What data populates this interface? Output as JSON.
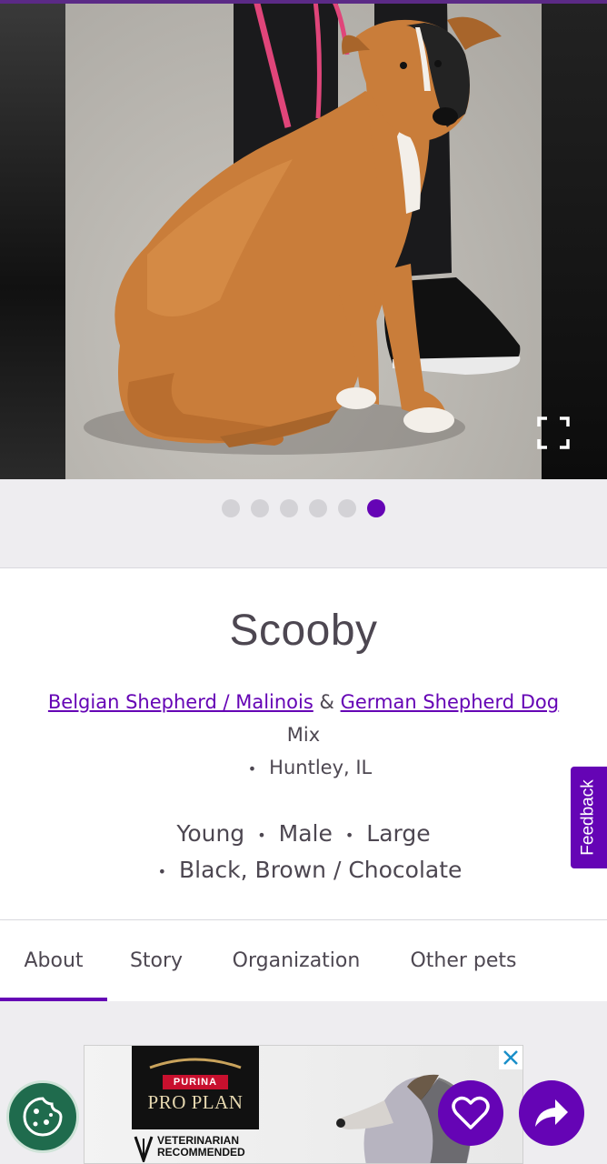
{
  "carousel": {
    "total_photos": 6,
    "active_index": 5,
    "dots": [
      {
        "active": false
      },
      {
        "active": false
      },
      {
        "active": false
      },
      {
        "active": false
      },
      {
        "active": false
      },
      {
        "active": true
      }
    ]
  },
  "pet": {
    "name": "Scooby",
    "breed_primary": "Belgian Shepherd / Malinois",
    "breed_joiner": "&",
    "breed_secondary": "German Shepherd Dog",
    "mix_label": "Mix",
    "location": "Huntley, IL",
    "age": "Young",
    "sex": "Male",
    "size": "Large",
    "colors": "Black, Brown / Chocolate"
  },
  "feedback": {
    "label": "Feedback"
  },
  "tabs": [
    {
      "label": "About",
      "active": true
    },
    {
      "label": "Story",
      "active": false
    },
    {
      "label": "Organization",
      "active": false
    },
    {
      "label": "Other pets",
      "active": false
    }
  ],
  "ad": {
    "brand_small": "PURINA",
    "brand_large": "PRO PLAN",
    "badge_line1": "VETERINARIAN",
    "badge_line2": "RECOMMENDED"
  },
  "colors": {
    "accent": "#6504b5",
    "text": "#4d4751",
    "band": "#eeedf0",
    "cookie_button": "#1f6b4d"
  },
  "icons": {
    "expand": "expand-icon",
    "close": "close-icon",
    "favorite": "heart-icon",
    "share": "share-icon",
    "cookie": "cookie-icon"
  }
}
